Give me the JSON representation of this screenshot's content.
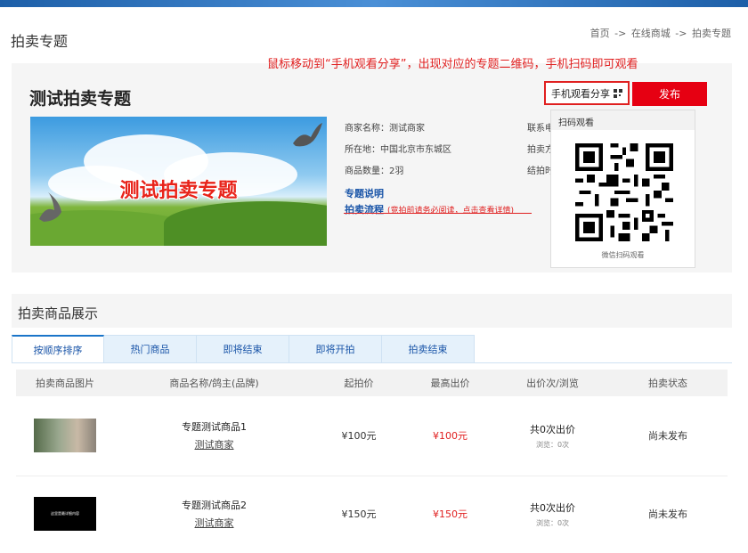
{
  "page": {
    "title": "拍卖专题"
  },
  "breadcrumb": {
    "home": "首页",
    "sep1": " -> ",
    "mall": "在线商城",
    "sep2": " -> ",
    "current": "拍卖专题"
  },
  "hint": "鼠标移动到“手机观看分享”，出现对应的专题二维码，手机扫码即可观看",
  "topic": {
    "title": "测试拍卖专题",
    "banner_text": "测试拍卖专题",
    "share_label": "手机观看分享",
    "publish_label": "发布",
    "merchant": "商家名称：测试商家",
    "location": "所在地：中国北京市东城区",
    "quantity": "商品数量：2羽",
    "contact_cut": "联系电",
    "method_cut": "拍卖方",
    "end_cut": "结拍时",
    "desc_link": "专题说明",
    "process_link": "拍卖流程",
    "process_note": "(竞拍前请务必阅读，点击查看详情)"
  },
  "qr_popup": {
    "title": "扫码观看",
    "caption": "微信扫码观看"
  },
  "section": {
    "title": "拍卖商品展示"
  },
  "tabs": [
    "按顺序排序",
    "热门商品",
    "即将结束",
    "即将开拍",
    "拍卖结束"
  ],
  "table": {
    "headers": [
      "拍卖商品图片",
      "商品名称/鸽主(品牌)",
      "起拍价",
      "最高出价",
      "出价次/浏览",
      "拍卖状态"
    ],
    "rows": [
      {
        "name": "专题测试商品1",
        "seller": "测试商家",
        "start": "¥100元",
        "high": "¥100元",
        "bids": "共0次出价",
        "views": "浏览：0次",
        "status": "尚未发布",
        "thumb_text": ""
      },
      {
        "name": "专题测试商品2",
        "seller": "测试商家",
        "start": "¥150元",
        "high": "¥150元",
        "bids": "共0次出价",
        "views": "浏览：0次",
        "status": "尚未发布",
        "thumb_text": "这里是最详细内容"
      }
    ]
  },
  "colors": {
    "accent_red": "#e60012",
    "link_blue": "#1a55a8",
    "tab_bg": "#e5f1fb"
  }
}
